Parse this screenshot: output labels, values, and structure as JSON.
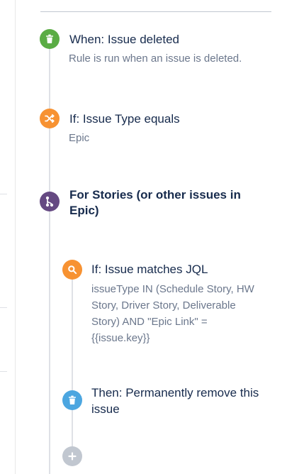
{
  "colors": {
    "trigger": "#5aac44",
    "condition": "#f79232",
    "branch": "#654982",
    "action": "#4ca6e0",
    "add": "#c1c7d0"
  },
  "flow": {
    "trigger": {
      "icon": "trash-icon",
      "title": "When: Issue deleted",
      "description": "Rule is run when an issue is deleted."
    },
    "condition": {
      "icon": "shuffle-icon",
      "title": "If: Issue Type equals",
      "description": "Epic"
    },
    "branch": {
      "icon": "branch-icon",
      "title_line1": "For Stories (or other issues in",
      "title_line2": "Epic)"
    },
    "jql_condition": {
      "icon": "search-icon",
      "title": "If: Issue matches JQL",
      "description_lines": [
        "issueType IN (Schedule Story, HW",
        "Story, Driver Story, Deliverable",
        "Story) AND \"Epic Link\" =",
        "{{issue.key}}"
      ]
    },
    "action": {
      "icon": "trash-icon",
      "title_line1": "Then: Permanently remove this",
      "title_line2": "issue"
    },
    "add_step": {
      "icon": "plus-icon"
    }
  }
}
